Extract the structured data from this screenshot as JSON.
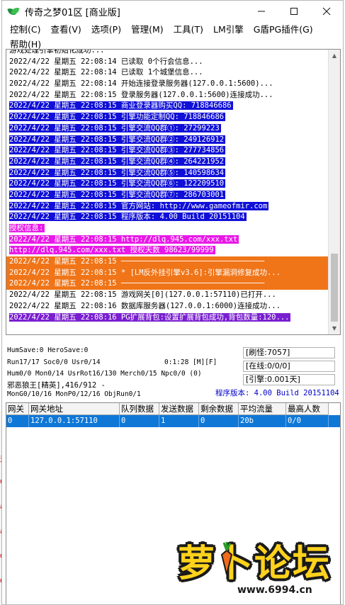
{
  "window": {
    "title": "传奇之梦01区 [商业版]",
    "minimize": "—",
    "maximize": "☐",
    "close": "✕"
  },
  "menu": [
    "控制(C)",
    "查看(V)",
    "选项(P)",
    "管理(M)",
    "工具(T)",
    "LM引擎",
    "G盾PG插件(G)",
    "帮助(H)"
  ],
  "log": [
    {
      "text": "游戏处理引擎初始化成功...",
      "style": "normal"
    },
    {
      "text": "2022/4/22 星期五 22:08:14 已读取 0个行会信息...",
      "style": "normal"
    },
    {
      "text": "2022/4/22 星期五 22:08:14 已读取 1个城堡信息...",
      "style": "normal"
    },
    {
      "text": "2022/4/22 星期五 22:08:14 开始连接登录服务器(127.0.0.1:5600)...",
      "style": "normal"
    },
    {
      "text": "2022/4/22 星期五 22:08:15 登录服务器(127.0.0.1:5600)连接成功...",
      "style": "normal"
    },
    {
      "text": "2022/4/22 星期五 22:08:15 商业登录器购买QQ: 718846686",
      "style": "blue"
    },
    {
      "text": "2022/4/22 星期五 22:08:15 引擎功能定制QQ: 718846686",
      "style": "blue"
    },
    {
      "text": "2022/4/22 星期五 22:08:15 引擎交流QQ群①: 27299223",
      "style": "blue"
    },
    {
      "text": "2022/4/22 星期五 22:08:15 引擎交流QQ群②: 249126912",
      "style": "blue"
    },
    {
      "text": "2022/4/22 星期五 22:08:15 引擎交流QQ群③: 277734856",
      "style": "blue"
    },
    {
      "text": "2022/4/22 星期五 22:08:15 引擎交流QQ群④: 264221952",
      "style": "blue"
    },
    {
      "text": "2022/4/22 星期五 22:08:15 引擎交流QQ群⑤: 140598634",
      "style": "blue"
    },
    {
      "text": "2022/4/22 星期五 22:08:15 引擎交流QQ群⑥: 122209510",
      "style": "blue"
    },
    {
      "text": "2022/4/22 星期五 22:08:15 引擎交流QQ群⑦: 286703001",
      "style": "blue"
    },
    {
      "text": "2022/4/22 星期五 22:08:15 官方网站: http://www.gameofmir.com",
      "style": "blue"
    },
    {
      "text": "2022/4/22 星期五 22:08:15 程序版本: 4.00 Build 20151104",
      "style": "blue"
    },
    {
      "text": "授权信息:",
      "style": "magenta"
    },
    {
      "text": "2022/4/22 星期五 22:08:15 http://dlq.945.com/xxx.txt",
      "style": "magenta"
    },
    {
      "text": "http://dlq.945.com/xxx.txt 授权天数 98623/99999",
      "style": "magenta"
    },
    {
      "text": "2022/4/22 星期五 22:08:15 ────────────────────────────────",
      "style": "orange-full"
    },
    {
      "text": "2022/4/22 星期五 22:08:15 * [LM反外挂引擎v3.6]:引擎漏洞修复成功...",
      "style": "orange-full"
    },
    {
      "text": "2022/4/22 星期五 22:08:15 ────────────────────────────────",
      "style": "orange-full"
    },
    {
      "text": "2022/4/22 星期五 22:08:15 游戏网关[0](127.0.0.1:57110)已打开...",
      "style": "normal"
    },
    {
      "text": "2022/4/22 星期五 22:08:16 数据库服务器(127.0.0.1:6000)连接成功...",
      "style": "normal"
    },
    {
      "text": "2022/4/22 星期五 22:08:16 PG扩展背包:设置扩展背包成功,背包数量:120...",
      "style": "purple"
    }
  ],
  "status": {
    "line1": "HumSave:0 HeroSave:0",
    "line2": "Run17/17 Soc0/0 Usr0/14",
    "timer": "0:1:28 [M][F]",
    "line3": "Hum0/0 Mon0/14 UsrRot16/130 Merch0/15 Npc0/0 (0)",
    "line4": "邪恶狼王[精英],416/912 -",
    "line5": "MonG0/10/16 MonP0/12/16 ObjRun0/1",
    "refresh": "[刷怪:7057]",
    "online": "[在线:0/0/0]",
    "engine": "[引擎:0.001天]",
    "version": "程序版本: 4.00 Build 20151104"
  },
  "gateway_table": {
    "columns": [
      "网关",
      "网关地址",
      "队列数据",
      "发送数据",
      "剩余数据",
      "平均流量",
      "最高人数"
    ],
    "rows": [
      [
        "0",
        "127.0.0.1:57110",
        "0",
        "1",
        "0",
        "20b",
        "0/0"
      ]
    ]
  },
  "background_edge": [
    "泥",
    "G",
    "a",
    "a",
    "G",
    "G"
  ],
  "watermark": {
    "main": "萝卜论坛",
    "domain": "www.6994.cn"
  }
}
